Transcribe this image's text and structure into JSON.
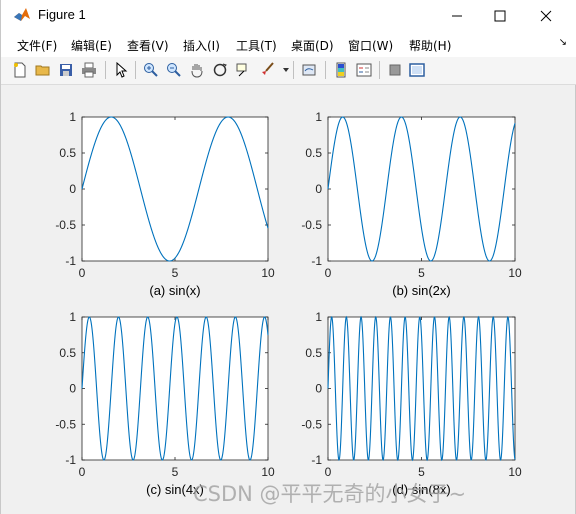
{
  "window": {
    "title": "Figure 1"
  },
  "menu": [
    {
      "label": "文件(F)"
    },
    {
      "label": "编辑(E)"
    },
    {
      "label": "查看(V)"
    },
    {
      "label": "插入(I)"
    },
    {
      "label": "工具(T)"
    },
    {
      "label": "桌面(D)"
    },
    {
      "label": "窗口(W)"
    },
    {
      "label": "帮助(H)"
    }
  ],
  "toolbar": {
    "icons": [
      "new-figure-icon",
      "open-folder-icon",
      "save-icon",
      "print-icon",
      "pointer-icon",
      "zoom-in-icon",
      "zoom-out-icon",
      "pan-hand-icon",
      "rotate-3d-icon",
      "data-cursor-icon",
      "brush-icon",
      "link-plot-icon",
      "colorbar-icon",
      "legend-icon",
      "hide-plot-tools-icon",
      "show-plot-tools-icon"
    ]
  },
  "colors": {
    "line": "#0072BD",
    "axes_bg": "#ffffff",
    "figure_bg": "#f0f0f0"
  },
  "chart_data": [
    {
      "type": "line",
      "title": "(a) sin(x)",
      "function": "sin(1*x)",
      "xlim": [
        0,
        10
      ],
      "ylim": [
        -1,
        1
      ],
      "xticks": [
        "0",
        "5",
        "10"
      ],
      "yticks": [
        "1",
        "0.5",
        "0",
        "-0.5",
        "-1"
      ],
      "frequency": 1
    },
    {
      "type": "line",
      "title": "(b) sin(2x)",
      "function": "sin(2*x)",
      "xlim": [
        0,
        10
      ],
      "ylim": [
        -1,
        1
      ],
      "xticks": [
        "0",
        "5",
        "10"
      ],
      "yticks": [
        "1",
        "0.5",
        "0",
        "-0.5",
        "-1"
      ],
      "frequency": 2
    },
    {
      "type": "line",
      "title": "(c) sin(4x)",
      "function": "sin(4*x)",
      "xlim": [
        0,
        10
      ],
      "ylim": [
        -1,
        1
      ],
      "xticks": [
        "0",
        "5",
        "10"
      ],
      "yticks": [
        "1",
        "0.5",
        "0",
        "-0.5",
        "-1"
      ],
      "frequency": 4
    },
    {
      "type": "line",
      "title": "(d) sin(8x)",
      "function": "sin(8*x)",
      "xlim": [
        0,
        10
      ],
      "ylim": [
        -1,
        1
      ],
      "xticks": [
        "0",
        "5",
        "10"
      ],
      "yticks": [
        "1",
        "0.5",
        "0",
        "-0.5",
        "-1"
      ],
      "frequency": 8
    }
  ],
  "watermark": "CSDN @平平无奇的小女子~"
}
